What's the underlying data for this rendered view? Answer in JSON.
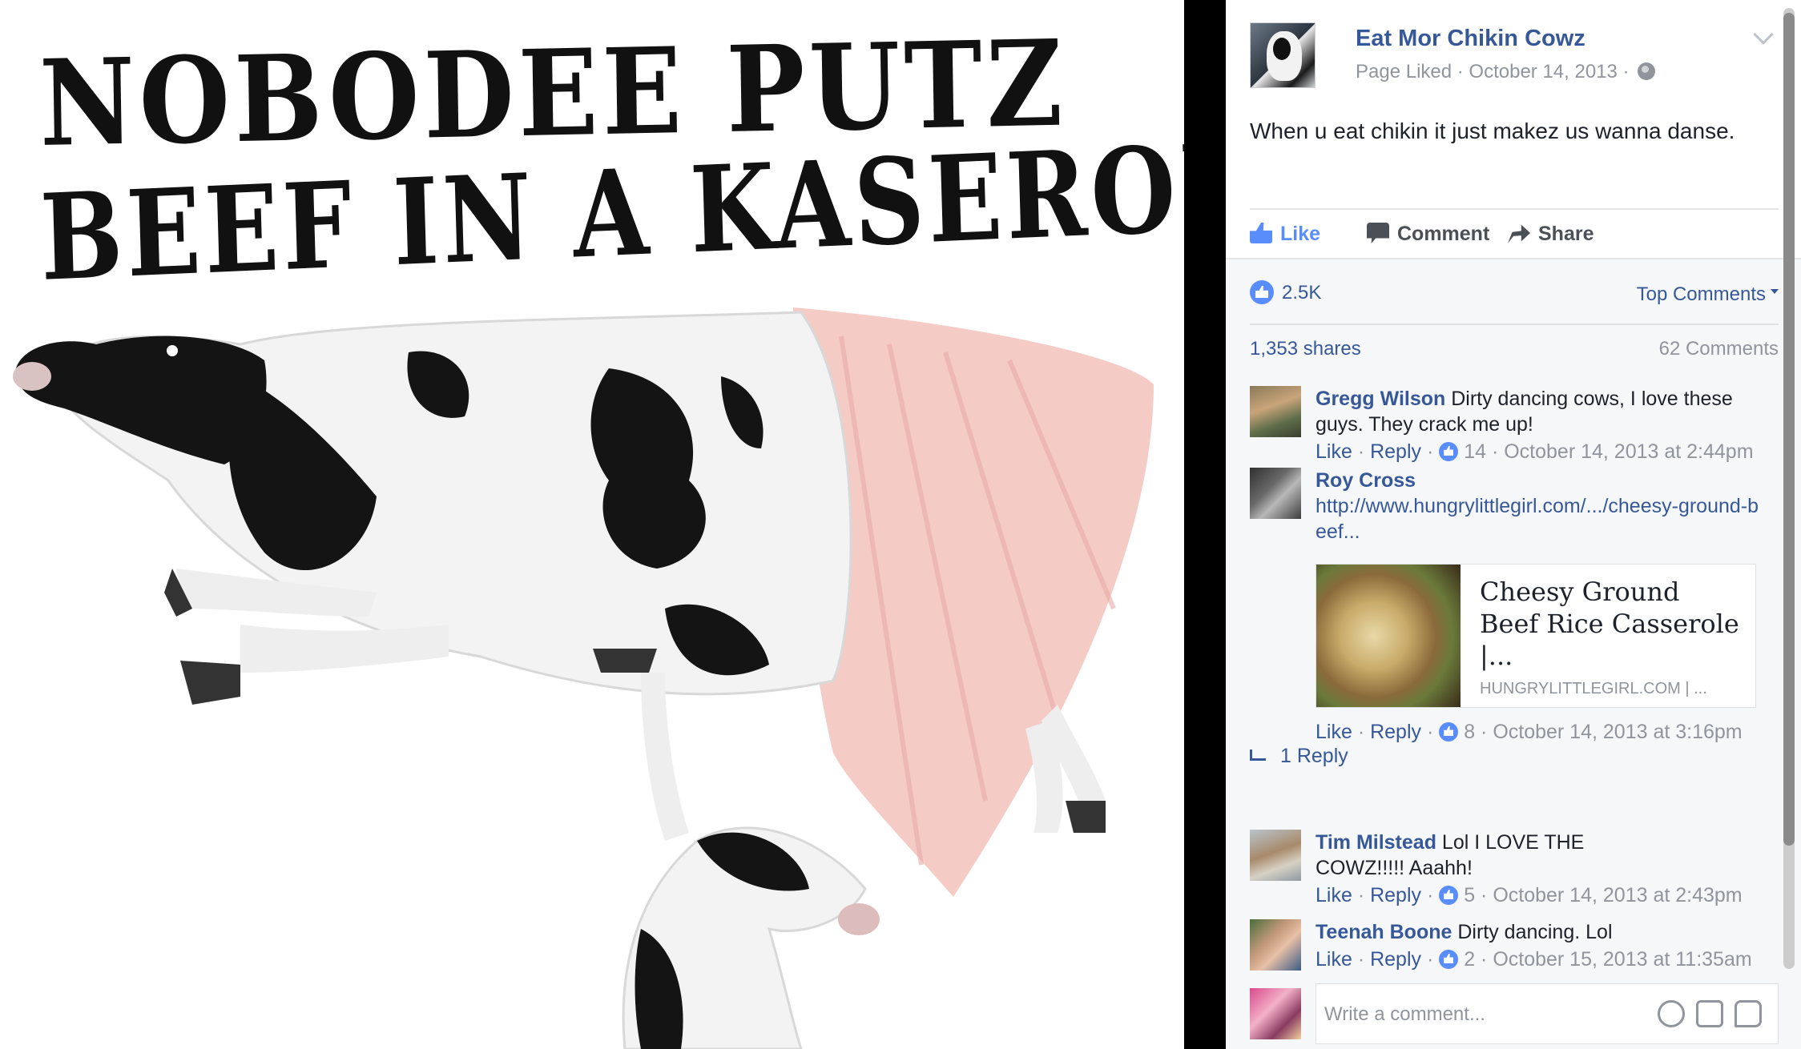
{
  "photo": {
    "headline_line1": "NOBODEE PUTZ",
    "headline_line2": "BEEF IN A KASEROLE"
  },
  "post": {
    "page_name": "Eat Mor Chikin Cowz",
    "meta": "Page Liked · October 14, 2013 ·",
    "text": "When u eat chikin it just makez us wanna danse.",
    "actions": {
      "like": "Like",
      "comment": "Comment",
      "share": "Share"
    },
    "reactions": {
      "count": "2.5K",
      "sort_label": "Top Comments"
    },
    "shares": "1,353 shares",
    "comments_count": "62 Comments"
  },
  "comments": [
    {
      "author": "Gregg Wilson",
      "text": "Dirty dancing cows, I love these guys. They crack me up!",
      "like": "Like",
      "reply": "Reply",
      "likes": "14",
      "time": "October 14, 2013 at 2:44pm"
    },
    {
      "author": "Roy Cross",
      "text": "http://www.hungrylittlegirl.com/.../cheesy-ground-beef...",
      "link_title": "Cheesy Ground Beef Rice Casserole |...",
      "link_domain": "HUNGRYLITTLEGIRL.COM | ...",
      "like": "Like",
      "reply": "Reply",
      "likes": "8",
      "time": "October 14, 2013 at 3:16pm",
      "replies_label": "1 Reply"
    },
    {
      "author": "Tim Milstead",
      "text": "Lol I LOVE THE COWZ!!!!! Aaahh!",
      "like": "Like",
      "reply": "Reply",
      "likes": "5",
      "time": "October 14, 2013 at 2:43pm"
    },
    {
      "author": "Teenah Boone",
      "text": "Dirty dancing. Lol",
      "like": "Like",
      "reply": "Reply",
      "likes": "2",
      "time": "October 15, 2013 at 11:35am"
    }
  ],
  "composer": {
    "placeholder": "Write a comment..."
  },
  "colors": {
    "link": "#365899",
    "like_blue": "#598dfb",
    "meta_grey": "#90949c",
    "panel_bg": "#f6f7f9"
  },
  "icons": [
    "globe-icon",
    "chevron-down-icon",
    "like-icon",
    "comment-icon",
    "share-icon",
    "reply-arrow-icon",
    "emoji-icon",
    "camera-icon",
    "sticker-icon"
  ]
}
